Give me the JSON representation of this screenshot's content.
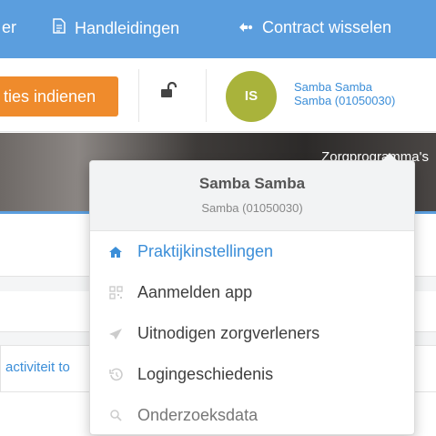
{
  "topnav": {
    "items": [
      {
        "label": "er",
        "icon": ""
      },
      {
        "label": "Handleidingen",
        "icon": "document-icon"
      },
      {
        "label": "Contract wisselen",
        "icon": "exchange-icon"
      }
    ]
  },
  "toolbar": {
    "orange_button_label": "ties indienen",
    "lock_icon": "unlock-icon"
  },
  "user": {
    "initials": "IS",
    "name_line1": "Samba Samba",
    "name_line2": "Samba (01050030)"
  },
  "banner": {
    "text": "Zorgprogramma's"
  },
  "background": {
    "link_text": "activiteit to"
  },
  "dropdown": {
    "name": "Samba Samba",
    "subtitle": "Samba (01050030)",
    "items": [
      {
        "label": "Praktijkinstellingen",
        "icon": "home-icon",
        "active": true
      },
      {
        "label": "Aanmelden app",
        "icon": "qr-code-icon",
        "active": false
      },
      {
        "label": "Uitnodigen zorgverleners",
        "icon": "paper-plane-icon",
        "active": false
      },
      {
        "label": "Logingeschiedenis",
        "icon": "history-icon",
        "active": false
      },
      {
        "label": "Onderzoeksdata",
        "icon": "research-icon",
        "active": false
      }
    ]
  },
  "colors": {
    "nav_blue": "#5b9ede",
    "orange": "#ef8b2c",
    "avatar_green": "#a9b33b",
    "link_blue": "#3b8ed8"
  }
}
